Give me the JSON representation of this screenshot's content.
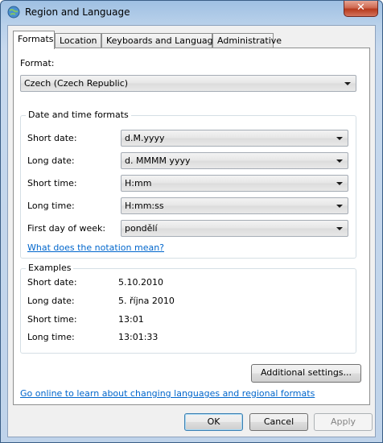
{
  "window": {
    "title": "Region and Language",
    "close_glyph": "✕"
  },
  "tabs": [
    {
      "label": "Formats",
      "active": true
    },
    {
      "label": "Location",
      "active": false
    },
    {
      "label": "Keyboards and Languages",
      "active": false
    },
    {
      "label": "Administrative",
      "active": false
    }
  ],
  "format": {
    "label": "Format:",
    "value": "Czech (Czech Republic)"
  },
  "date_time": {
    "group_title": "Date and time formats",
    "short_date": {
      "label": "Short date:",
      "value": "d.M.yyyy"
    },
    "long_date": {
      "label": "Long date:",
      "value": "d. MMMM yyyy"
    },
    "short_time": {
      "label": "Short time:",
      "value": "H:mm"
    },
    "long_time": {
      "label": "Long time:",
      "value": "H:mm:ss"
    },
    "first_day": {
      "label": "First day of week:",
      "value": "pondělí"
    },
    "notation_link": "What does the notation mean?"
  },
  "examples": {
    "group_title": "Examples",
    "short_date": {
      "label": "Short date:",
      "value": "5.10.2010"
    },
    "long_date": {
      "label": "Long date:",
      "value": "5. října 2010"
    },
    "short_time": {
      "label": "Short time:",
      "value": "13:01"
    },
    "long_time": {
      "label": "Long time:",
      "value": "13:01:33"
    }
  },
  "additional_settings_label": "Additional settings...",
  "online_link": "Go online to learn about changing languages and regional formats",
  "buttons": {
    "ok": "OK",
    "cancel": "Cancel",
    "apply": "Apply"
  },
  "colors": {
    "link": "#0066cc",
    "title_bar": "#b9d1ea",
    "close_button": "#c7503a"
  },
  "icons": {
    "app": "globe-clock-icon",
    "close": "close-icon",
    "dropdown": "chevron-down-icon"
  }
}
